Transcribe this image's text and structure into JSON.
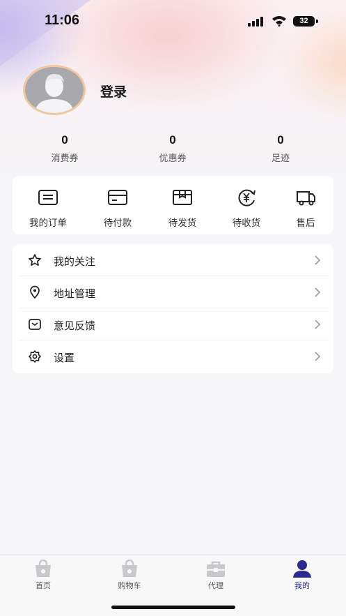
{
  "status_bar": {
    "time": "11:06",
    "battery": "32"
  },
  "profile": {
    "login_label": "登录"
  },
  "stats": [
    {
      "value": "0",
      "label": "消费券"
    },
    {
      "value": "0",
      "label": "优惠券"
    },
    {
      "value": "0",
      "label": "足迹"
    }
  ],
  "orders": [
    {
      "label": "我的订单",
      "icon": "order-list-icon"
    },
    {
      "label": "待付款",
      "icon": "card-icon"
    },
    {
      "label": "待发货",
      "icon": "box-icon"
    },
    {
      "label": "待收货",
      "icon": "yen-refresh-icon"
    },
    {
      "label": "售后",
      "icon": "truck-icon"
    }
  ],
  "menu": [
    {
      "label": "我的关注",
      "icon": "star-icon"
    },
    {
      "label": "地址管理",
      "icon": "location-pin-icon"
    },
    {
      "label": "意见反馈",
      "icon": "feedback-icon"
    },
    {
      "label": "设置",
      "icon": "gear-icon"
    }
  ],
  "tabs": [
    {
      "label": "首页",
      "icon": "bag-icon"
    },
    {
      "label": "购物车",
      "icon": "bag-icon"
    },
    {
      "label": "代理",
      "icon": "toolbox-icon"
    },
    {
      "label": "我的",
      "icon": "user-icon",
      "active": true
    }
  ],
  "colors": {
    "active_tab": "#2a2a8f",
    "inactive_icon": "#c8c8cd"
  }
}
